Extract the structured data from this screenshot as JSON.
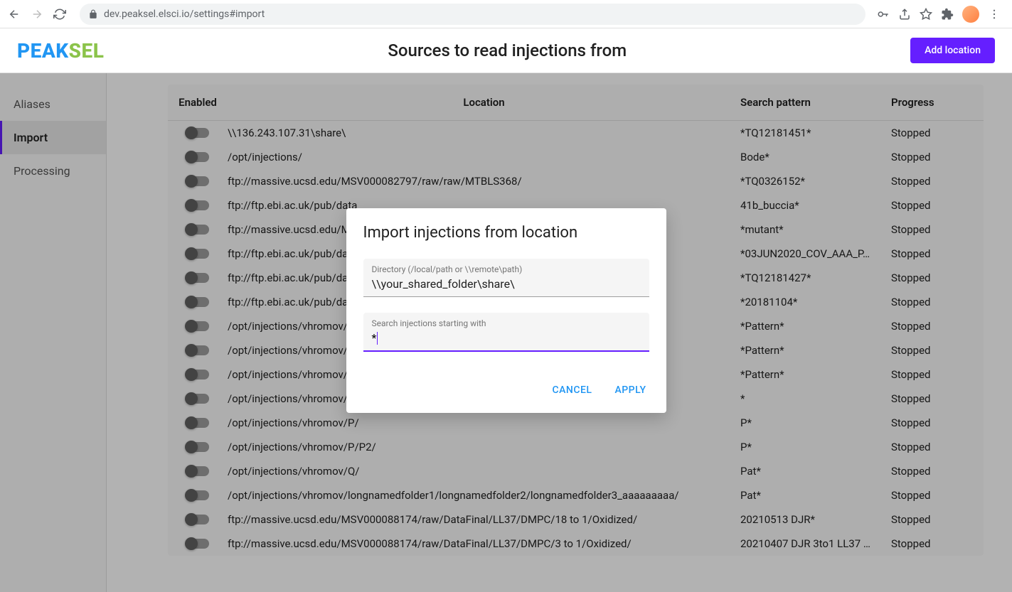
{
  "browser": {
    "url": "dev.peaksel.elsci.io/settings#import"
  },
  "logo": {
    "part1": "PEAK",
    "part2": "SEL"
  },
  "page": {
    "title": "Sources to read injections from",
    "add_button": "Add location"
  },
  "sidebar": {
    "items": [
      {
        "label": "Aliases",
        "active": false
      },
      {
        "label": "Import",
        "active": true
      },
      {
        "label": "Processing",
        "active": false
      }
    ]
  },
  "table": {
    "headers": {
      "enabled": "Enabled",
      "location": "Location",
      "pattern": "Search pattern",
      "progress": "Progress"
    },
    "rows": [
      {
        "location": "\\\\136.243.107.31\\share\\",
        "pattern": "*TQ12181451*",
        "progress": "Stopped"
      },
      {
        "location": "/opt/injections/",
        "pattern": "Bode*",
        "progress": "Stopped"
      },
      {
        "location": "ftp://massive.ucsd.edu/MSV000082797/raw/raw/MTBLS368/",
        "pattern": "*TQ0326152*",
        "progress": "Stopped"
      },
      {
        "location": "ftp://ftp.ebi.ac.uk/pub/data",
        "pattern": "41b_buccia*",
        "progress": "Stopped"
      },
      {
        "location": "ftp://massive.ucsd.edu/MS",
        "pattern": "*mutant*",
        "progress": "Stopped"
      },
      {
        "location": "ftp://ftp.ebi.ac.uk/pub/data",
        "pattern": "*03JUN2020_COV_AAA_P…",
        "progress": "Stopped"
      },
      {
        "location": "ftp://ftp.ebi.ac.uk/pub/data",
        "pattern": "*TQ12181427*",
        "progress": "Stopped"
      },
      {
        "location": "ftp://ftp.ebi.ac.uk/pub/data",
        "pattern": "*20181104*",
        "progress": "Stopped"
      },
      {
        "location": "/opt/injections/vhromov/j/",
        "pattern": "*Pattern*",
        "progress": "Stopped"
      },
      {
        "location": "/opt/injections/vhromov/i/",
        "pattern": "*Pattern*",
        "progress": "Stopped"
      },
      {
        "location": "/opt/injections/vhromov/k/",
        "pattern": "*Pattern*",
        "progress": "Stopped"
      },
      {
        "location": "/opt/injections/vhromov/onesting/Pattern_folder_test/",
        "pattern": "*",
        "progress": "Stopped"
      },
      {
        "location": "/opt/injections/vhromov/P/",
        "pattern": "P*",
        "progress": "Stopped"
      },
      {
        "location": "/opt/injections/vhromov/P/P2/",
        "pattern": "P*",
        "progress": "Stopped"
      },
      {
        "location": "/opt/injections/vhromov/Q/",
        "pattern": "Pat*",
        "progress": "Stopped"
      },
      {
        "location": "/opt/injections/vhromov/longnamedfolder1/longnamedfolder2/longnamedfolder3_aaaaaaaaa/",
        "pattern": "Pat*",
        "progress": "Stopped"
      },
      {
        "location": "ftp://massive.ucsd.edu/MSV000088174/raw/DataFinal/LL37/DMPC/18 to 1/Oxidized/",
        "pattern": "20210513 DJR*",
        "progress": "Stopped"
      },
      {
        "location": "ftp://massive.ucsd.edu/MSV000088174/raw/DataFinal/LL37/DMPC/3 to 1/Oxidized/",
        "pattern": "20210407 DJR 3to1 LL37 …",
        "progress": "Stopped"
      }
    ]
  },
  "modal": {
    "title": "Import injections from location",
    "directory_label": "Directory (/local/path or \\\\remote\\path)",
    "directory_value": "\\\\your_shared_folder\\share\\",
    "pattern_label": "Search injections starting with",
    "pattern_value": "*",
    "cancel": "CANCEL",
    "apply": "APPLY"
  }
}
